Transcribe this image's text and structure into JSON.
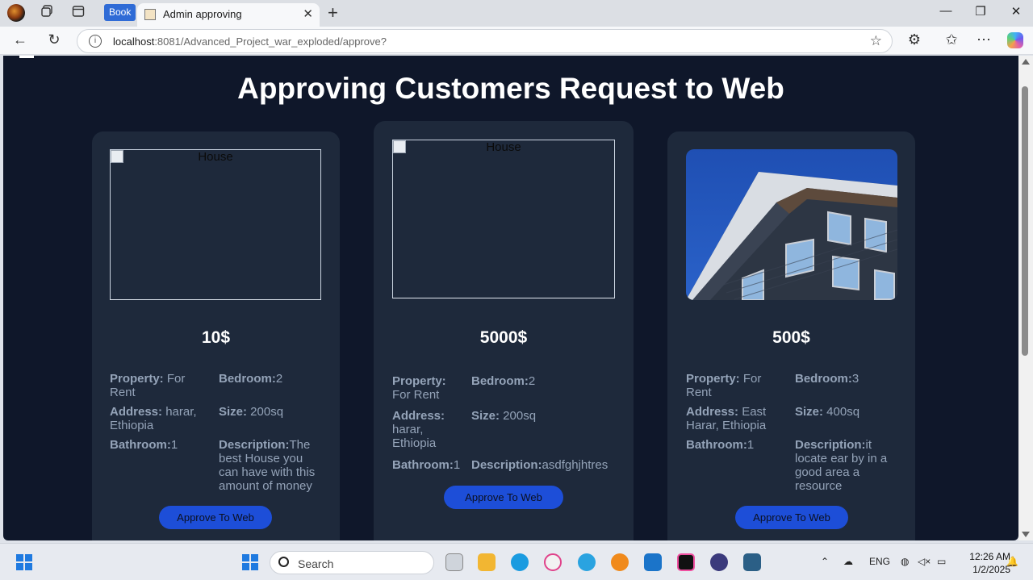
{
  "browser": {
    "tab_group_label": "Book",
    "active_tab_title": "Admin approving",
    "url_host": "localhost",
    "url_rest": ":8081/Advanced_Project_war_exploded/approve?"
  },
  "page": {
    "heading": "Approving Customers Request to Web",
    "cards": [
      {
        "image_alt": "House",
        "image_broken": true,
        "price": "10$",
        "property_label": "Property:",
        "property_value": " For Rent",
        "bedroom_label": "Bedroom:",
        "bedroom_value": "2",
        "address_label": "Address:",
        "address_value": " harar, Ethiopia",
        "size_label": "Size:",
        "size_value": " 200sq",
        "bathroom_label": "Bathroom:",
        "bathroom_value": "1",
        "description_label": "Description:",
        "description_value": "The best House you can have with this amount of money",
        "button_label": "Approve To Web"
      },
      {
        "image_alt": "House",
        "image_broken": true,
        "price": "5000$",
        "property_label": "Property:",
        "property_value": " For Rent",
        "bedroom_label": "Bedroom:",
        "bedroom_value": "2",
        "address_label": "Address:",
        "address_value": " harar, Ethiopia",
        "size_label": "Size:",
        "size_value": " 200sq",
        "bathroom_label": "Bathroom:",
        "bathroom_value": "1",
        "description_label": "Description:",
        "description_value": "asdfghjhtres",
        "button_label": "Approve To Web"
      },
      {
        "image_alt": "House",
        "image_broken": false,
        "price": "500$",
        "property_label": "Property:",
        "property_value": " For Rent",
        "bedroom_label": "Bedroom:",
        "bedroom_value": "3",
        "address_label": "Address:",
        "address_value": " East Harar, Ethiopia",
        "size_label": "Size:",
        "size_value": " 400sq",
        "bathroom_label": "Bathroom:",
        "bathroom_value": "1",
        "description_label": "Description:",
        "description_value": "it locate ear by in a good area a resource",
        "button_label": "Approve To Web"
      }
    ]
  },
  "taskbar": {
    "search_placeholder": "Search",
    "language": "ENG",
    "time": "12:26 AM",
    "date": "1/2/2025"
  },
  "colors": {
    "page_bg": "#0f172a",
    "card_bg": "#1e293b",
    "button_bg": "#1d4ed8",
    "muted_text": "#94a3b8"
  },
  "icons": {
    "browser": [
      "profile-avatar",
      "workspaces-icon",
      "tab-actions-icon",
      "close-icon",
      "plus-icon",
      "minimize-icon",
      "restore-icon",
      "window-close-icon",
      "back-arrow-icon",
      "refresh-icon",
      "info-icon",
      "star-icon",
      "extensions-icon",
      "favorites-icon",
      "more-icon",
      "copilot-icon"
    ],
    "taskbar": [
      "windows-start-icon",
      "search-icon",
      "task-view-icon",
      "file-explorer-icon",
      "edge-icon",
      "itunes-icon",
      "telegram-icon",
      "app-orange-icon",
      "vscode-icon",
      "intellij-icon",
      "eclipse-icon",
      "mysql-workbench-icon",
      "chevron-up-icon",
      "cloud-off-icon",
      "globe-icon",
      "mute-icon",
      "battery-icon",
      "bell-icon"
    ]
  }
}
